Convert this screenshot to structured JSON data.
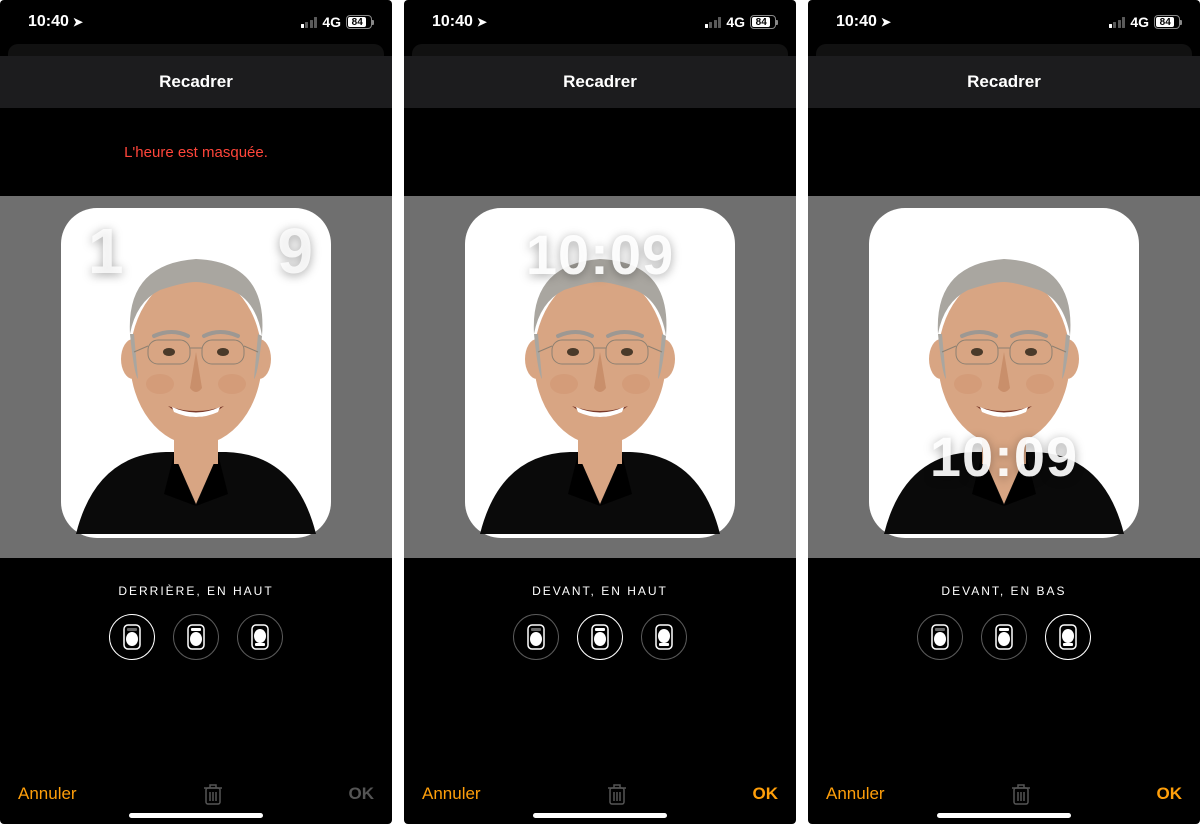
{
  "status": {
    "time": "10:40",
    "location_icon": "location-arrow",
    "signal_bars_active": 1,
    "network": "4G",
    "battery_percent": "84"
  },
  "header": {
    "title": "Recadrer"
  },
  "screens": [
    {
      "warning": "L'heure est masquée.",
      "preview_time": "10:09",
      "time_visible_fragment_left": "1",
      "time_visible_fragment_right": "9",
      "position_label": "DERRIÈRE, EN HAUT",
      "clock_layer": "behind",
      "clock_vpos": "top",
      "selected_option": 0,
      "footer": {
        "cancel": "Annuler",
        "confirm": "OK",
        "confirm_enabled": false,
        "trash_enabled": false
      }
    },
    {
      "warning": "",
      "preview_time": "10:09",
      "position_label": "DEVANT, EN HAUT",
      "clock_layer": "front",
      "clock_vpos": "top",
      "selected_option": 1,
      "footer": {
        "cancel": "Annuler",
        "confirm": "OK",
        "confirm_enabled": true,
        "trash_enabled": false
      }
    },
    {
      "warning": "",
      "preview_time": "10:09",
      "position_label": "DEVANT, EN BAS",
      "clock_layer": "front",
      "clock_vpos": "bottom",
      "selected_option": 2,
      "footer": {
        "cancel": "Annuler",
        "confirm": "OK",
        "confirm_enabled": true,
        "trash_enabled": false
      }
    }
  ],
  "options": [
    {
      "id": "behind-top",
      "label": "DERRIÈRE, EN HAUT"
    },
    {
      "id": "front-top",
      "label": "DEVANT, EN HAUT"
    },
    {
      "id": "front-bottom",
      "label": "DEVANT, EN BAS"
    }
  ]
}
